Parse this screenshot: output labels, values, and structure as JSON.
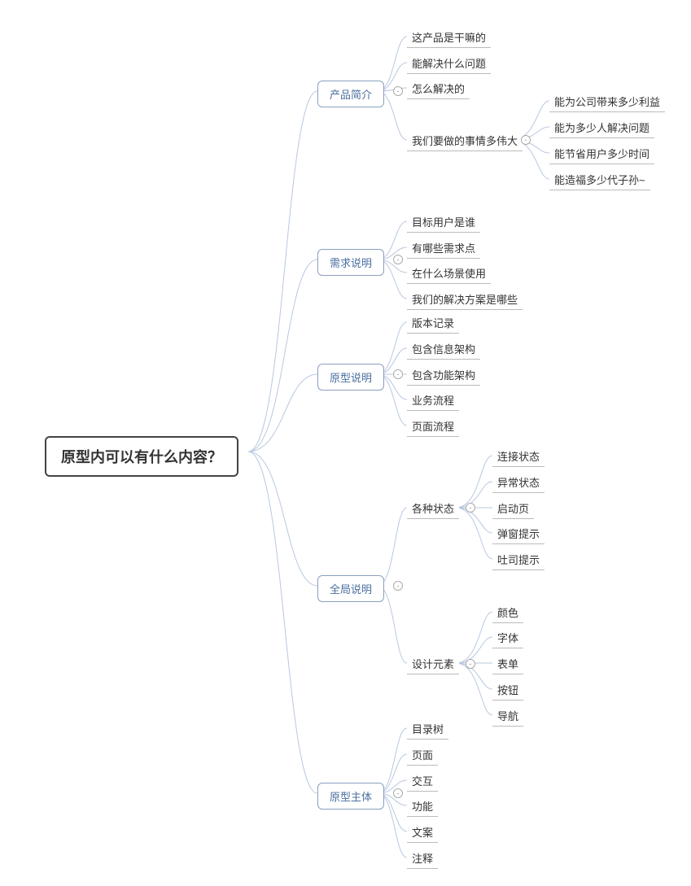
{
  "root": "原型内可以有什么内容？",
  "branches": [
    {
      "label": "产品简介"
    },
    {
      "label": "需求说明"
    },
    {
      "label": "原型说明"
    },
    {
      "label": "全局说明"
    },
    {
      "label": "原型主体"
    }
  ],
  "l1": {
    "b0_0": "这产品是干嘛的",
    "b0_1": "能解决什么问题",
    "b0_2": "怎么解决的",
    "b0_3": "我们要做的事情多伟大",
    "b1_0": "目标用户是谁",
    "b1_1": "有哪些需求点",
    "b1_2": "在什么场景使用",
    "b1_3": "我们的解决方案是哪些",
    "b2_0": "版本记录",
    "b2_1": "包含信息架构",
    "b2_2": "包含功能架构",
    "b2_3": "业务流程",
    "b2_4": "页面流程",
    "b3_0": "各种状态",
    "b3_1": "设计元素",
    "b4_0": "目录树",
    "b4_1": "页面",
    "b4_2": "交互",
    "b4_3": "功能",
    "b4_4": "文案",
    "b4_5": "注释"
  },
  "l2": {
    "g0_0": "能为公司带来多少利益",
    "g0_1": "能为多少人解决问题",
    "g0_2": "能节省用户多少时间",
    "g0_3": "能造福多少代子孙~",
    "g3a_0": "连接状态",
    "g3a_1": "异常状态",
    "g3a_2": "启动页",
    "g3a_3": "弹窗提示",
    "g3a_4": "吐司提示",
    "g3b_0": "颜色",
    "g3b_1": "字体",
    "g3b_2": "表单",
    "g3b_3": "按钮",
    "g3b_4": "导航"
  }
}
